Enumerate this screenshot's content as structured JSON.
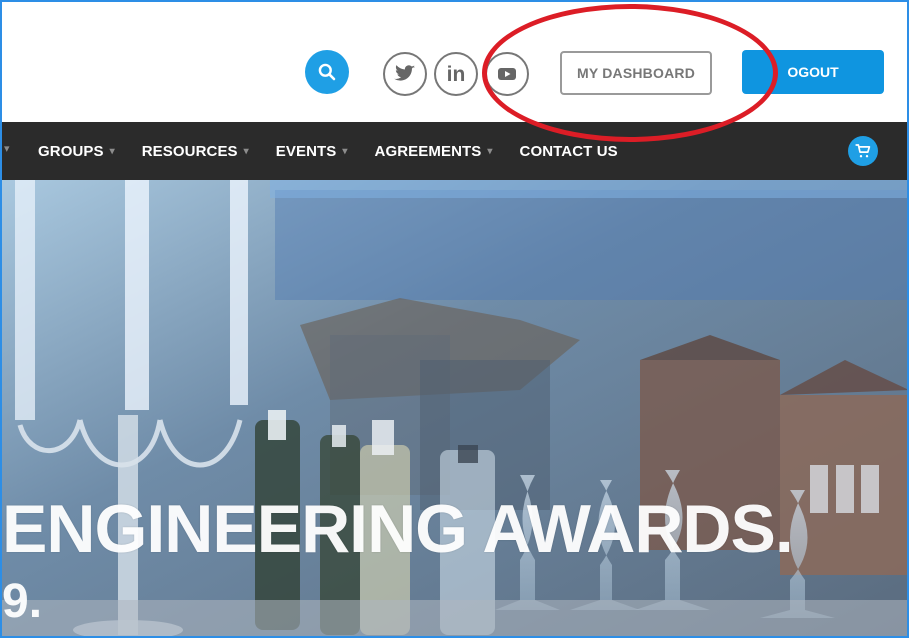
{
  "header": {
    "social": {
      "linkedin_label": "in"
    },
    "my_dashboard_label": "MY DASHBOARD",
    "logout_label": "OGOUT"
  },
  "nav": {
    "items": [
      {
        "label": "GROUPS",
        "chevron": "▾"
      },
      {
        "label": "RESOURCES",
        "chevron": "▾"
      },
      {
        "label": "EVENTS",
        "chevron": "▾"
      },
      {
        "label": "AGREEMENTS",
        "chevron": "▾"
      },
      {
        "label": "CONTACT US",
        "chevron": ""
      }
    ]
  },
  "hero": {
    "title": "ENGINEERING AWARDS.",
    "subtitle": "9."
  },
  "colors": {
    "accent": "#1f9fe5",
    "logout_button": "#0f95e0",
    "nav_background": "#2b2b2b",
    "highlight": "#dc1d26"
  }
}
